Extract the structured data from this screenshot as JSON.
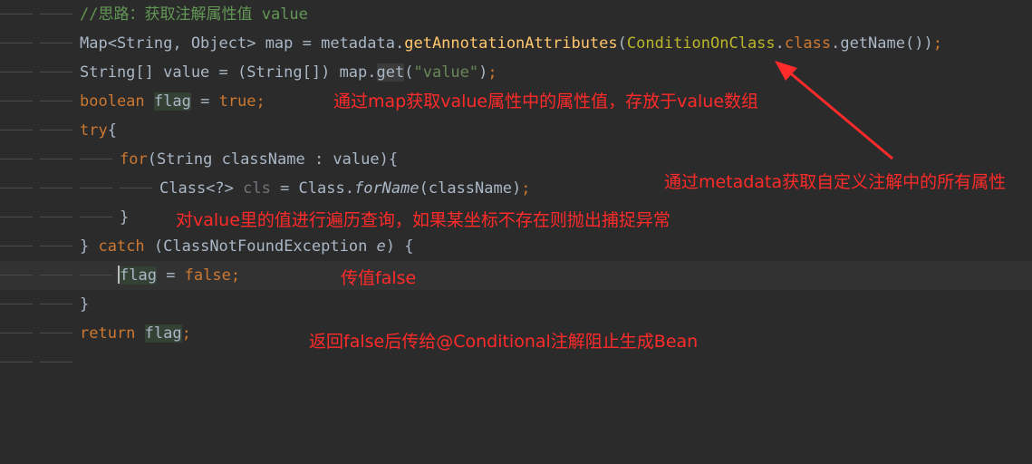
{
  "code": {
    "line1": {
      "comment": "//思路：获取注解属性值 value"
    },
    "line2": {
      "t1": "Map<String, Object> map = metadata.",
      "method": "getAnnotationAttributes",
      "t2": "(",
      "ann": "ConditionOnClass",
      "t3": ".",
      "kw": "class",
      "t4": ".getName())",
      "t5": ";"
    },
    "line3": {
      "t1": "String[] value = (String[]) map.",
      "get": "get",
      "t2": "(",
      "str": "\"value\"",
      "t3": ")",
      "t4": ";"
    },
    "line4": {
      "kw": "boolean",
      "sp": " ",
      "flag": "flag",
      "t1": " = ",
      "val": "true",
      "t2": ";"
    },
    "line5": {
      "kw": "try",
      "t1": "{"
    },
    "line6": {
      "kw": "for",
      "t1": "(String className : value){"
    },
    "line7": {
      "t1": "Class<?> ",
      "cls": "cls",
      "t2": " = Class.",
      "forName": "forName",
      "t3": "(className)",
      "t4": ";"
    },
    "line8": {
      "t1": "}"
    },
    "line9": {
      "t1": "} ",
      "kw": "catch",
      "t2": " (ClassNotFoundException ",
      "e": "e",
      "t3": ") {"
    },
    "line10": {
      "flag": "flag",
      "t1": " = ",
      "val": "false",
      "t2": ";"
    },
    "line11": {
      "t1": "}"
    },
    "line12": {
      "kw": "return",
      "sp": " ",
      "flag": "flag",
      "t1": ";"
    }
  },
  "annotations": {
    "a1": "通过map获取value属性中的属性值，存放于value数组",
    "a2": "通过metadata获取自定义注解中的所有属性",
    "a3": "对value里的值进行遍历查询，如果某坐标不存在则抛出捕捉异常",
    "a4": "传值false",
    "a5": "返回false后传给@Conditional注解阻止生成Bean"
  },
  "colors": {
    "background": "#2b2b2b",
    "annotation": "#ff2a2a",
    "keyword": "#cc7832",
    "comment": "#629755"
  }
}
